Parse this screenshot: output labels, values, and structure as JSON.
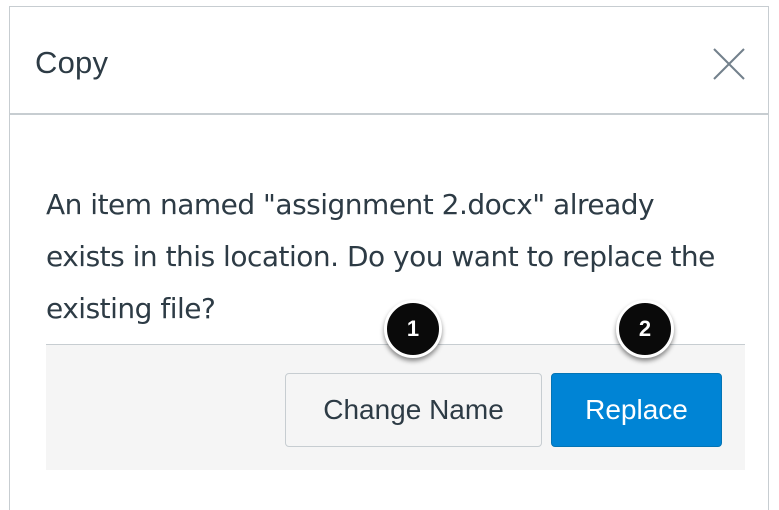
{
  "dialog": {
    "title": "Copy",
    "close_icon": "close-icon",
    "message_lines": [
      "An item named \"assignment 2.docx\" already",
      "exists in this location. Do you want to replace the",
      "existing file?"
    ]
  },
  "footer": {
    "change_name_label": "Change Name",
    "replace_label": "Replace"
  },
  "callouts": [
    "1",
    "2"
  ],
  "colors": {
    "primary": "#0084d5",
    "text": "#2d3b45",
    "border": "#c7cdd1",
    "footer_bg": "#f5f5f5",
    "callout_bg": "#0a0a0a"
  }
}
